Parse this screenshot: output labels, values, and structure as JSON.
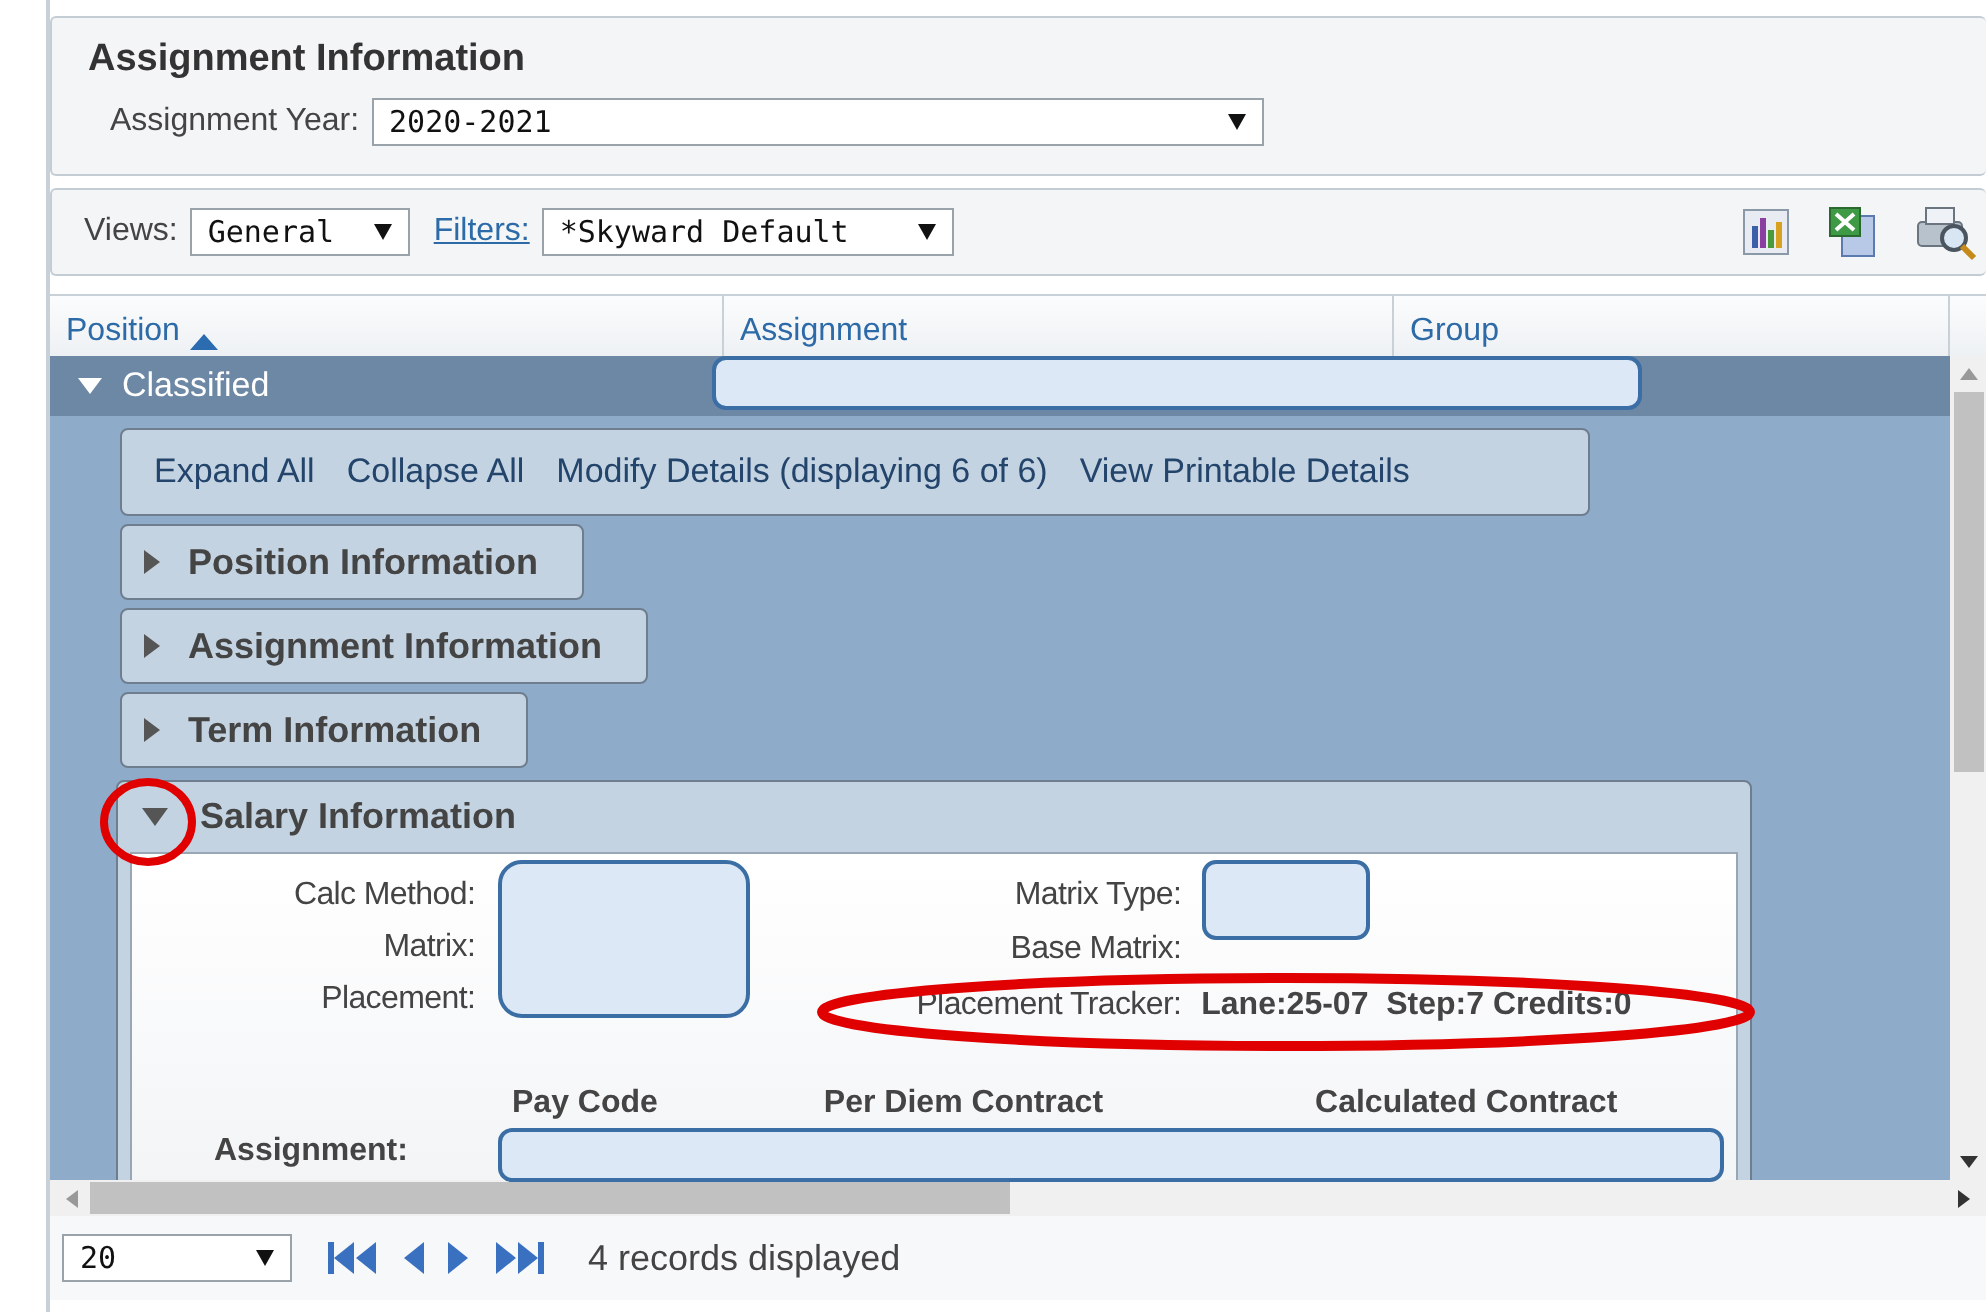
{
  "header": {
    "title": "Assignment Information",
    "year_label": "Assignment Year:",
    "year_value": "2020-2021"
  },
  "toolbar": {
    "views_label": "Views:",
    "view_value": "General",
    "filters_link": "Filters:",
    "filter_value": "*Skyward Default"
  },
  "grid": {
    "columns": [
      {
        "label": "Position",
        "sorted": true
      },
      {
        "label": "Assignment",
        "sorted": false
      },
      {
        "label": "Group",
        "sorted": false
      }
    ],
    "group": {
      "label": "Classified",
      "expanded": true
    },
    "actions": [
      "Expand All",
      "Collapse All",
      "Modify Details (displaying 6 of 6)",
      "View Printable Details"
    ],
    "sections": [
      {
        "label": "Position Information",
        "expanded": false
      },
      {
        "label": "Assignment Information",
        "expanded": false
      },
      {
        "label": "Term Information",
        "expanded": false
      },
      {
        "label": "Salary Information",
        "expanded": true
      }
    ],
    "salary": {
      "left_fields": [
        "Calc Method:",
        "Matrix:",
        "Placement:"
      ],
      "right_fields": [
        {
          "label": "Matrix Type:"
        },
        {
          "label": "Base Matrix:"
        },
        {
          "label": "Placement Tracker:",
          "value": "Lane:25-07  Step:7 Credits:0"
        }
      ],
      "columns": [
        "Pay Code",
        "Per Diem Contract",
        "Calculated Contract"
      ],
      "row_label": "Assignment:"
    }
  },
  "footer": {
    "page_size": "20",
    "records": "4 records displayed"
  }
}
